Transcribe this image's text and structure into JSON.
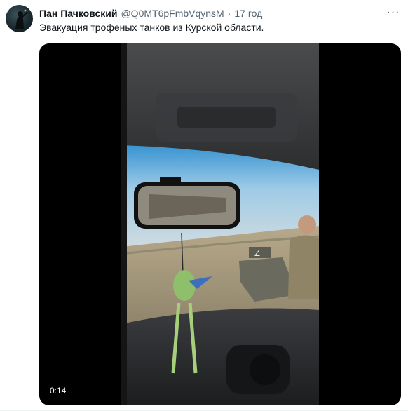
{
  "author": {
    "name": "Пан Пачковский",
    "handle": "@Q0MT6pFmbVqynsM",
    "separator": "·",
    "time": "17 год",
    "avatar_icon": "night-soldier-avatar-icon"
  },
  "tweet": {
    "text": "Эвакуация трофеных танков из Курской области."
  },
  "actions": {
    "more_icon": "more-horizontal-icon",
    "more_label": "···"
  },
  "video": {
    "duration": "0:14"
  },
  "colors": {
    "text_primary": "#0f1419",
    "text_secondary": "#536471",
    "media_bg": "#000000"
  }
}
